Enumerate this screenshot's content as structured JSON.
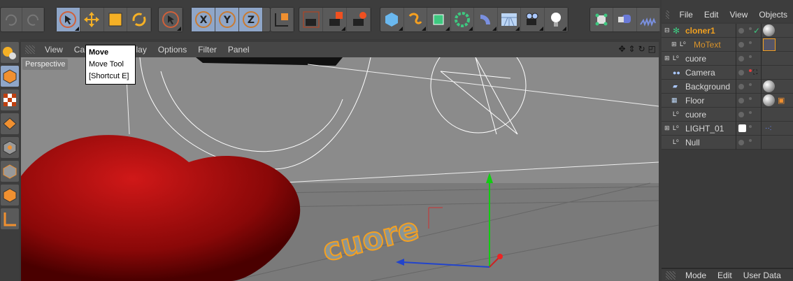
{
  "toolbar": {
    "groups": [
      {
        "name": "undo-redo",
        "icons": [
          "undo-icon",
          "redo-icon"
        ]
      },
      {
        "name": "tools",
        "icons": [
          "live-selection-icon",
          "move-icon",
          "scale-icon",
          "rotate-icon"
        ],
        "selected": "move-icon"
      },
      {
        "name": "selection",
        "icons": [
          "selection-icon"
        ]
      },
      {
        "name": "axes",
        "icons": [
          "x-axis-icon",
          "y-axis-icon",
          "z-axis-icon",
          "coordinate-system-icon"
        ],
        "labels": [
          "X",
          "Y",
          "Z"
        ]
      },
      {
        "name": "render",
        "icons": [
          "render-view-icon",
          "render-picture-viewer-icon",
          "render-settings-icon"
        ]
      },
      {
        "name": "objects",
        "icons": [
          "cube-icon",
          "spline-pen-icon",
          "subdivision-icon",
          "cloner-icon",
          "deformer-icon",
          "floor-icon",
          "camera-icon",
          "light-icon"
        ]
      },
      {
        "name": "extras",
        "icons": [
          "polygon-object-icon",
          "tag-icon",
          "spring-icon"
        ]
      }
    ]
  },
  "viewport": {
    "menu": [
      "View",
      "Cameras",
      "Display",
      "Options",
      "Filter",
      "Panel"
    ],
    "view_label": "Perspective",
    "tooltip": {
      "title": "Move",
      "line1": "Move Tool",
      "line2": "[Shortcut E]"
    },
    "nav_icons": [
      "pan-icon",
      "zoom-icon",
      "orbit-icon",
      "maximize-icon"
    ],
    "scene_text": "cuore"
  },
  "object_manager": {
    "menu": [
      "File",
      "Edit",
      "View",
      "Objects"
    ],
    "objects": [
      {
        "name": "cloner1",
        "level": 0,
        "expand": "-",
        "type": "cloner",
        "active": true
      },
      {
        "name": "MoText",
        "level": 1,
        "expand": "+",
        "type": "null",
        "child": true
      },
      {
        "name": "cuore",
        "level": 0,
        "expand": "+",
        "type": "null"
      },
      {
        "name": "Camera",
        "level": 0,
        "type": "camera"
      },
      {
        "name": "Background",
        "level": 0,
        "type": "background"
      },
      {
        "name": "Floor",
        "level": 0,
        "type": "floor"
      },
      {
        "name": "cuore",
        "level": 0,
        "type": "null"
      },
      {
        "name": "LIGHT_01",
        "level": 0,
        "expand": "+",
        "type": "null"
      },
      {
        "name": "Null",
        "level": 0,
        "type": "null"
      }
    ]
  },
  "attributes": {
    "menu": [
      "Mode",
      "Edit",
      "User Data"
    ]
  },
  "colors": {
    "accent": "#f0a020",
    "selected_tool": "#8fa6c8",
    "heart": "#b01010",
    "viewport_bg": "#8b8b8b"
  }
}
